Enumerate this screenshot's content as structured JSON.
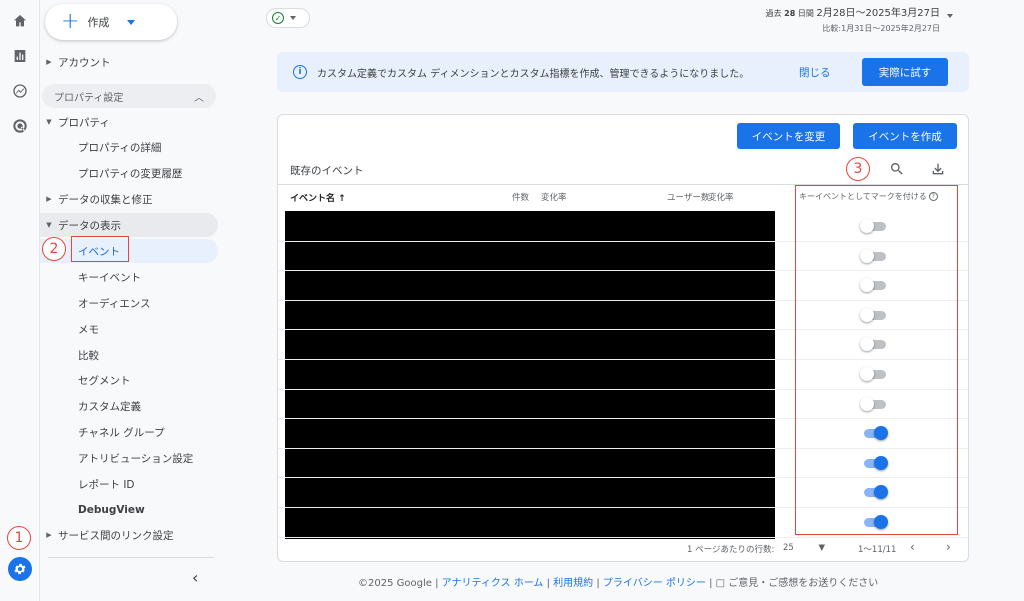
{
  "rail": {
    "icons": [
      "home-icon",
      "reports-icon",
      "explore-icon",
      "advertising-icon"
    ],
    "settings_icon": "gear-icon"
  },
  "annotations": {
    "one": "1",
    "two": "2",
    "three": "3"
  },
  "sidebar": {
    "create_label": "作成",
    "account": "アカウント",
    "property_settings": "プロパティ設定",
    "property": "プロパティ",
    "property_details": "プロパティの詳細",
    "property_history": "プロパティの変更履歴",
    "data_collection": "データの収集と修正",
    "data_display": "データの表示",
    "items": [
      "イベント",
      "キーイベント",
      "オーディエンス",
      "メモ",
      "比較",
      "セグメント",
      "カスタム定義",
      "チャネル グループ",
      "アトリビューション設定",
      "レポート ID",
      "DebugView"
    ],
    "service_links": "サービス間のリンク設定"
  },
  "header": {
    "date_prefix": "過去",
    "date_days": "28",
    "date_unit": "日間",
    "date_range": "2月28日～2025年3月27日",
    "compare_range": "比較:1月31日～2025年2月27日"
  },
  "banner": {
    "message": "カスタム定義でカスタム ディメンションとカスタム指標を作成、管理できるようになりました。",
    "close_label": "閉じる",
    "try_label": "実際に試す"
  },
  "card": {
    "modify_event": "イベントを変更",
    "create_event": "イベントを作成",
    "title": "既存のイベント",
    "columns": {
      "event_name": "イベント名 ↑",
      "count": "件数",
      "change1": "変化率",
      "users": "ユーザー数",
      "change2": "変化率",
      "key_event": "キーイベントとしてマークを付ける"
    },
    "toggles": [
      false,
      false,
      false,
      false,
      false,
      false,
      false,
      true,
      true,
      true,
      true
    ],
    "rows_per_page_label": "1 ページあたりの行数:",
    "rows_per_page": "25",
    "range": "1～11/11"
  },
  "footer": {
    "copyright": "©2025 Google |",
    "home": "アナリティクス ホーム",
    "terms": "利用規約",
    "privacy": "プライバシー ポリシー",
    "feedback": "ご意見・ご感想をお送りください",
    "sep": "|"
  }
}
